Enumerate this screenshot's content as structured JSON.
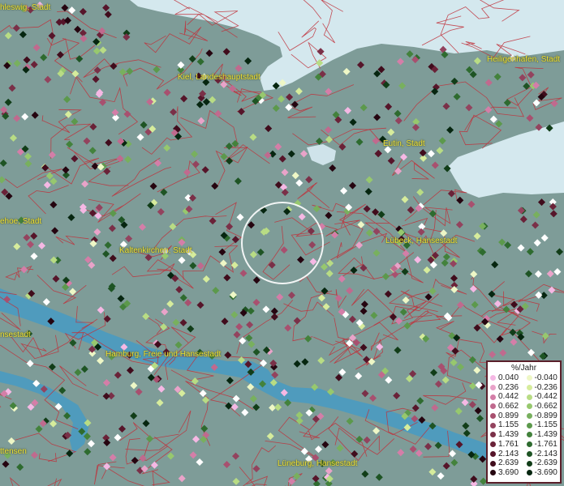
{
  "map": {
    "labels": {
      "schleswig": "hleswig, Stadt",
      "heiligenhafen": "Heiligenhafen, Stadt",
      "kiel": "Kiel, Landeshauptstadt",
      "eutin": "Eutin, Stadt",
      "itzehoe": "ehoe, Stadt",
      "kaltenkirchen": "Kaltenkirchen, Stadt",
      "luebeck": "Lübeck, Hansestadt",
      "hansestadt_left": "nsestadt",
      "hamburg": "Hamburg, Freie und Hansestadt",
      "ottensen": "ttensen",
      "lueneburg": "Lüneburg, Hansestadt"
    },
    "colors": {
      "land": "#7e9c98",
      "sea": "#d4e8ee",
      "river": "#4f9bbd",
      "borders": "#c0303a",
      "label_text": "#f1e23a"
    }
  },
  "legend": {
    "title": "%/Jahr",
    "positive": [
      {
        "value": "0.040",
        "color": "#f5b8e4"
      },
      {
        "value": "0.236",
        "color": "#e9a3c9"
      },
      {
        "value": "0.442",
        "color": "#d47ea8"
      },
      {
        "value": "0.662",
        "color": "#c06a8e"
      },
      {
        "value": "0.899",
        "color": "#a8506f"
      },
      {
        "value": "1.155",
        "color": "#93435e"
      },
      {
        "value": "1.439",
        "color": "#7a3048"
      },
      {
        "value": "1.761",
        "color": "#6a2238"
      },
      {
        "value": "2.143",
        "color": "#56152a"
      },
      {
        "value": "2.639",
        "color": "#400c1c"
      },
      {
        "value": "3.690",
        "color": "#250510"
      }
    ],
    "negative": [
      {
        "value": "-0.040",
        "color": "#eef7c6"
      },
      {
        "value": "-0.236",
        "color": "#d6ec9c"
      },
      {
        "value": "-0.442",
        "color": "#b8dc84"
      },
      {
        "value": "-0.662",
        "color": "#97c86e"
      },
      {
        "value": "-0.899",
        "color": "#78b05e"
      },
      {
        "value": "-1.155",
        "color": "#5c994c"
      },
      {
        "value": "-1.439",
        "color": "#43823c"
      },
      {
        "value": "-1.761",
        "color": "#2e6b2f"
      },
      {
        "value": "-2.143",
        "color": "#1e5424"
      },
      {
        "value": "-2.639",
        "color": "#113d18"
      },
      {
        "value": "-3.690",
        "color": "#062610"
      }
    ]
  }
}
